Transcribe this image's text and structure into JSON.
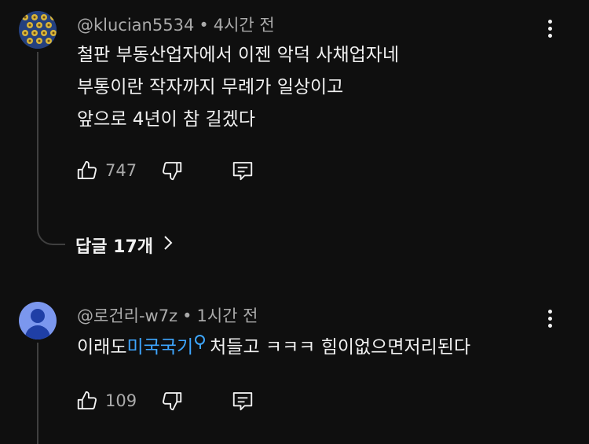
{
  "comments": [
    {
      "username": "@klucian5534",
      "time": "4시간 전",
      "lines": [
        "철판 부동산업자에서 이젠 악덕 사채업자네",
        "부통이란 작자까지 무례가 일상이고",
        "앞으로 4년이 참 길겠다"
      ],
      "likes": "747",
      "replies_label": "답글 17개"
    },
    {
      "username": "@로건리-w7z",
      "time": "1시간 전",
      "text_before": "이래도",
      "link_text": "미국국기",
      "text_after": "처들고 ㅋㅋㅋ  힘이없으면저리된다",
      "likes": "109"
    }
  ],
  "separator": "•",
  "icons": [
    "thumb-up-icon",
    "thumb-down-icon",
    "reply-icon",
    "more-vert-icon",
    "chevron-right-icon",
    "search-icon"
  ],
  "colors": {
    "background": "#0f0f0f",
    "text": "#f1f1f1",
    "secondary": "#aaaaaa",
    "link": "#3ea6ff"
  }
}
